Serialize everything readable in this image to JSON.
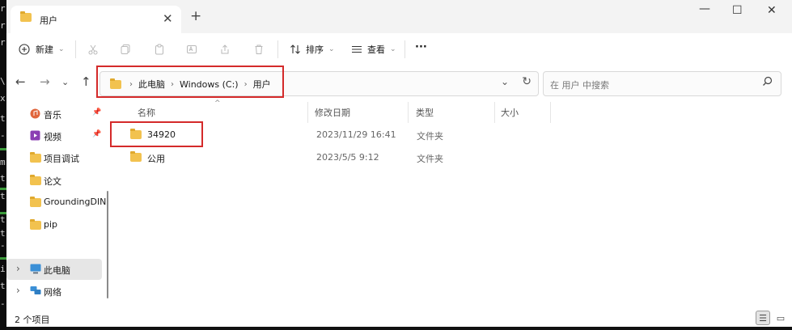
{
  "terminal": {
    "chars": [
      "r",
      "r",
      "r",
      "\\",
      "x",
      "t",
      "-",
      "m",
      "t",
      "t",
      "-",
      "t",
      "t",
      "-",
      "i",
      "t",
      "-"
    ]
  },
  "window": {
    "tab_title": "用户",
    "new_tab": "+",
    "controls": {
      "minimize": "—",
      "maximize": "☐",
      "close": "✕"
    },
    "tab_close": "✕"
  },
  "toolbar": {
    "new_label": "新建",
    "sort_label": "排序",
    "view_label": "查看",
    "more_label": "···"
  },
  "address": {
    "crumbs": [
      "此电脑",
      "Windows (C:)",
      "用户"
    ],
    "search_placeholder": "在 用户 中搜索"
  },
  "sidebar": {
    "items": [
      {
        "label": "音乐",
        "icon": "music-icon",
        "pinned": true
      },
      {
        "label": "视频",
        "icon": "video-icon",
        "pinned": true
      },
      {
        "label": "项目调试",
        "icon": "folder-icon"
      },
      {
        "label": "论文",
        "icon": "folder-icon"
      },
      {
        "label": "GroundingDIN",
        "icon": "folder-icon"
      },
      {
        "label": "pip",
        "icon": "folder-icon"
      },
      {
        "label": "此电脑",
        "icon": "computer-icon",
        "expander": "›",
        "selected": true
      },
      {
        "label": "网络",
        "icon": "network-icon",
        "expander": "›"
      }
    ]
  },
  "columns": {
    "name": "名称",
    "modified": "修改日期",
    "type": "类型",
    "size": "大小"
  },
  "files": [
    {
      "name": "34920",
      "modified": "2023/11/29 16:41",
      "type": "文件夹",
      "size": ""
    },
    {
      "name": "公用",
      "modified": "2023/5/5 9:12",
      "type": "文件夹",
      "size": ""
    }
  ],
  "status": {
    "count": "2 个项目"
  },
  "colors": {
    "highlight_box": "#d42a2a",
    "folder": "#f2c24f"
  }
}
